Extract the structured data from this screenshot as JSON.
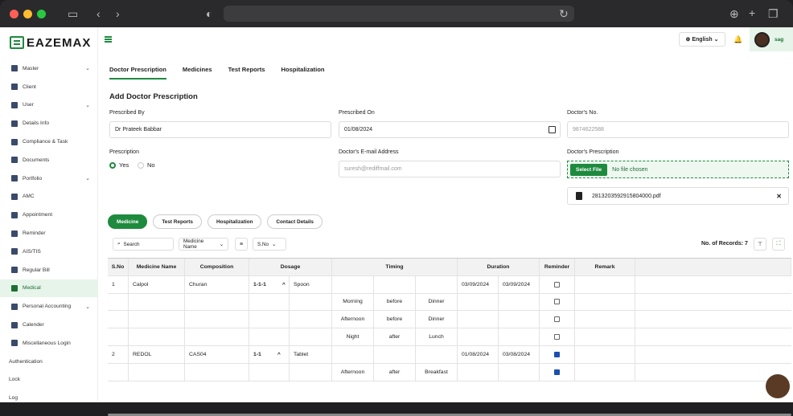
{
  "brand": {
    "name": "EAZEMAX"
  },
  "sidebar": {
    "items": [
      {
        "label": "Master",
        "chev": true
      },
      {
        "label": "Client"
      },
      {
        "label": "User",
        "chev": true
      },
      {
        "label": "Details Info"
      },
      {
        "label": "Compliance & Task"
      },
      {
        "label": "Documents"
      },
      {
        "label": "Portfolio",
        "chev": true
      },
      {
        "label": "AMC"
      },
      {
        "label": "Appointment"
      },
      {
        "label": "Reminder"
      },
      {
        "label": "AIS/TIS"
      },
      {
        "label": "Regular Bill"
      },
      {
        "label": "Medical",
        "active": true
      },
      {
        "label": "Personal Accounting",
        "chev": true
      },
      {
        "label": "Calender"
      },
      {
        "label": "Miscellaneous Login"
      },
      {
        "label": "Authentication",
        "plain": true
      },
      {
        "label": "Lock",
        "plain": true
      },
      {
        "label": "Log",
        "plain": true
      }
    ]
  },
  "header": {
    "language": "English",
    "user": "sag"
  },
  "tabs": [
    "Doctor Prescription",
    "Medicines",
    "Test Reports",
    "Hospitalization"
  ],
  "form": {
    "title": "Add Doctor Prescription",
    "prescribed_by_label": "Prescribed By",
    "prescribed_by": "Dr Prateek Babbar",
    "prescribed_on_label": "Prescribed On",
    "prescribed_on": "01/08/2024",
    "doctor_no_label": "Doctor's No.",
    "doctor_no": "9874622588",
    "prescription_label": "Prescription",
    "yes": "Yes",
    "no": "No",
    "email_label": "Doctor's E-mail Address",
    "email": "suresh@rediffmail.com",
    "doc_presc_label": "Doctor's Prescription",
    "select_file": "Select File",
    "no_file": "No file chosen",
    "pdf_name": "2813203592915804000.pdf",
    "remove": "✕"
  },
  "subtabs": [
    "Medicine",
    "Test Reports",
    "Hospitalization",
    "Contact Details"
  ],
  "toolbar": {
    "search_placeholder": "Search",
    "medicine_name": "Medicine Name",
    "sno": "S.No",
    "records": "No. of Records: 7"
  },
  "table": {
    "headers": [
      "S.No",
      "Medicine Name",
      "Composition",
      "Dosage",
      "Timing",
      "Duration",
      "Reminder",
      "Remark"
    ],
    "rows": [
      [
        "1",
        "Calpol",
        "Churan",
        "1-1-1",
        "^",
        "Spoon",
        "",
        "",
        "",
        "03/09/2024",
        "03/09/2024",
        "off",
        ""
      ],
      [
        "",
        "",
        "",
        "",
        "",
        "",
        "Morning",
        "before",
        "Dinner",
        "",
        "",
        "off",
        ""
      ],
      [
        "",
        "",
        "",
        "",
        "",
        "",
        "Afternoon",
        "before",
        "Dinner",
        "",
        "",
        "off",
        ""
      ],
      [
        "",
        "",
        "",
        "",
        "",
        "",
        "Night",
        "after",
        "Lunch",
        "",
        "",
        "off",
        ""
      ],
      [
        "2",
        "REDOL",
        "CAS04",
        "1-1",
        "^",
        "Tablet",
        "",
        "",
        "",
        "01/08/2024",
        "03/08/2024",
        "on",
        ""
      ],
      [
        "",
        "",
        "",
        "",
        "",
        "",
        "Afternoon",
        "after",
        "Breakfast",
        "",
        "",
        "on",
        ""
      ]
    ]
  }
}
